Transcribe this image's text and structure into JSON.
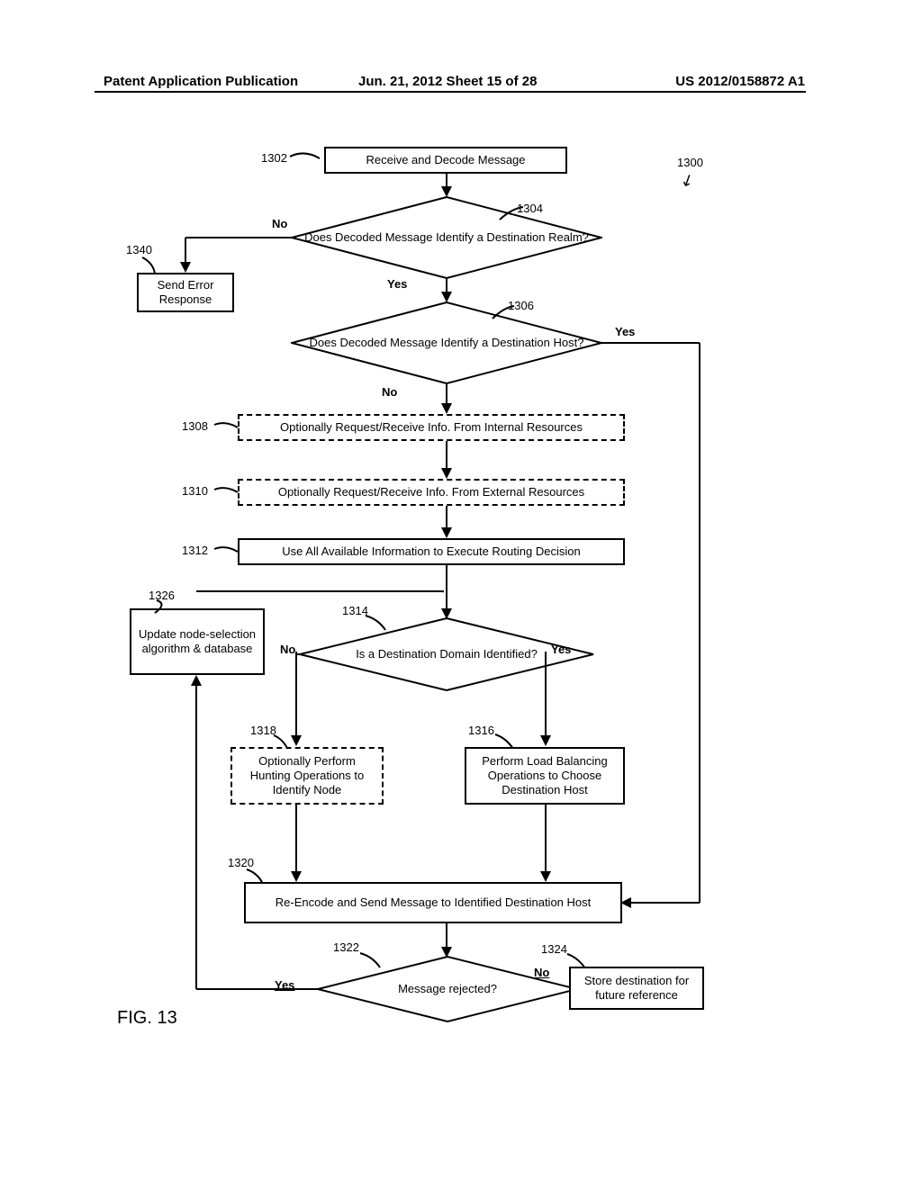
{
  "header": {
    "left": "Patent Application Publication",
    "mid": "Jun. 21, 2012  Sheet 15 of 28",
    "right": "US 2012/0158872 A1"
  },
  "refs": {
    "r1302": "1302",
    "r1304": "1304",
    "r1306": "1306",
    "r1308": "1308",
    "r1310": "1310",
    "r1312": "1312",
    "r1314": "1314",
    "r1316": "1316",
    "r1318": "1318",
    "r1320": "1320",
    "r1322": "1322",
    "r1324": "1324",
    "r1326": "1326",
    "r1340": "1340",
    "r1300": "1300"
  },
  "boxes": {
    "b1302": "Receive and Decode Message",
    "b1340": "Send Error Response",
    "b1308": "Optionally Request/Receive Info. From Internal Resources",
    "b1310": "Optionally Request/Receive Info. From External Resources",
    "b1312": "Use All Available Information to Execute Routing Decision",
    "b1326": "Update node-selection algorithm & database",
    "b1318": "Optionally Perform Hunting Operations to Identify Node",
    "b1316": "Perform Load Balancing Operations to Choose Destination Host",
    "b1320": "Re-Encode and Send Message to Identified Destination Host",
    "b1324": "Store destination for future reference"
  },
  "diamonds": {
    "d1304": "Does Decoded Message Identify a Destination Realm?",
    "d1306": "Does Decoded Message Identify a Destination Host?",
    "d1314": "Is a Destination Domain Identified?",
    "d1322": "Message rejected?"
  },
  "labels": {
    "no": "No",
    "yes": "Yes"
  },
  "figure": "FIG. 13"
}
